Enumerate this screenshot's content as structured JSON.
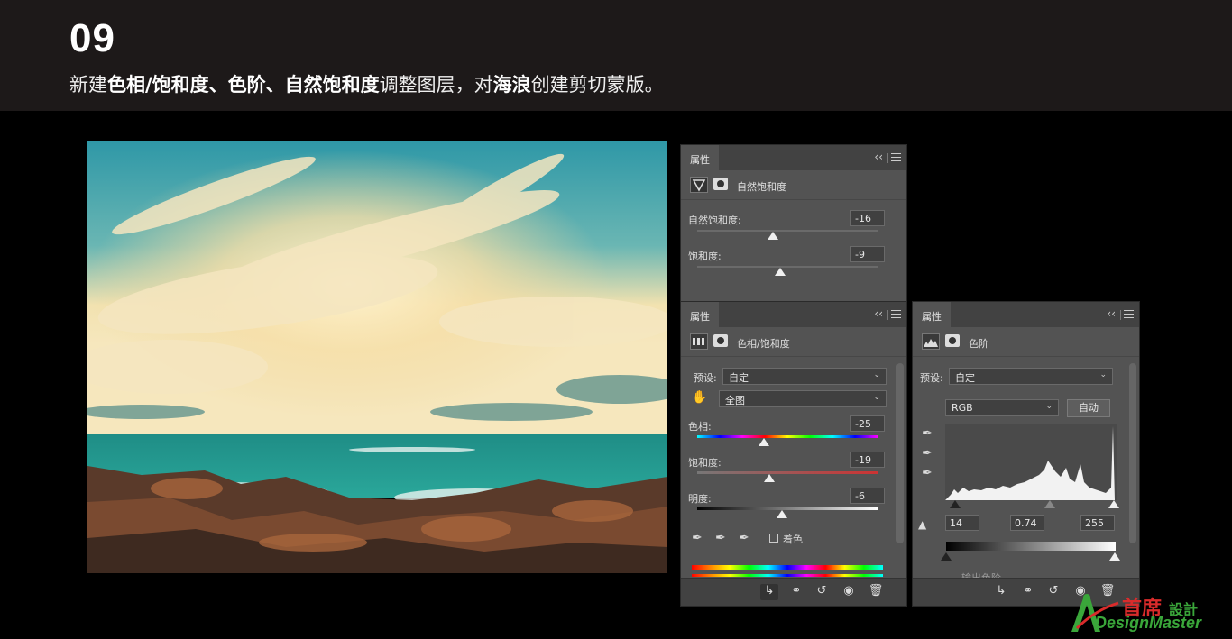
{
  "header": {
    "step": "09",
    "instruction": [
      {
        "text": "新建",
        "bold": false
      },
      {
        "text": "色相/饱和度、色阶、自然饱和度",
        "bold": true
      },
      {
        "text": "调整图层，对",
        "bold": false
      },
      {
        "text": "海浪",
        "bold": true
      },
      {
        "text": "创建剪切蒙版。",
        "bold": false
      }
    ]
  },
  "panel_vibrance": {
    "tab": "属性",
    "layer_name": "自然饱和度",
    "vibrance_label": "自然饱和度:",
    "vibrance_value": "-16",
    "vibrance_level": 0.42,
    "saturation_label": "饱和度:",
    "saturation_value": "-9",
    "saturation_level": 0.46
  },
  "panel_hue": {
    "tab": "属性",
    "layer_name": "色相/饱和度",
    "preset_label": "预设:",
    "preset_value": "自定",
    "channel_value": "全图",
    "hue_label": "色相:",
    "hue_value": "-25",
    "hue_level": 0.37,
    "sat_label": "饱和度:",
    "sat_value": "-19",
    "sat_level": 0.4,
    "light_label": "明度:",
    "light_value": "-6",
    "light_level": 0.47,
    "colorize_label": "着色"
  },
  "panel_levels": {
    "tab": "属性",
    "layer_name": "色阶",
    "preset_label": "预设:",
    "preset_value": "自定",
    "channel_value": "RGB",
    "auto_label": "自动",
    "input_black": "14",
    "input_gamma": "0.74",
    "input_white": "255",
    "output_label": "输出色阶"
  },
  "logo": {
    "cn": "首席",
    "cn_small": "設計",
    "en": "DesignMaster"
  },
  "colors": {
    "header_bg": "#1d1919",
    "panel_bg": "#535353",
    "logo_green": "#3aa63a",
    "logo_red": "#d92b2b"
  }
}
